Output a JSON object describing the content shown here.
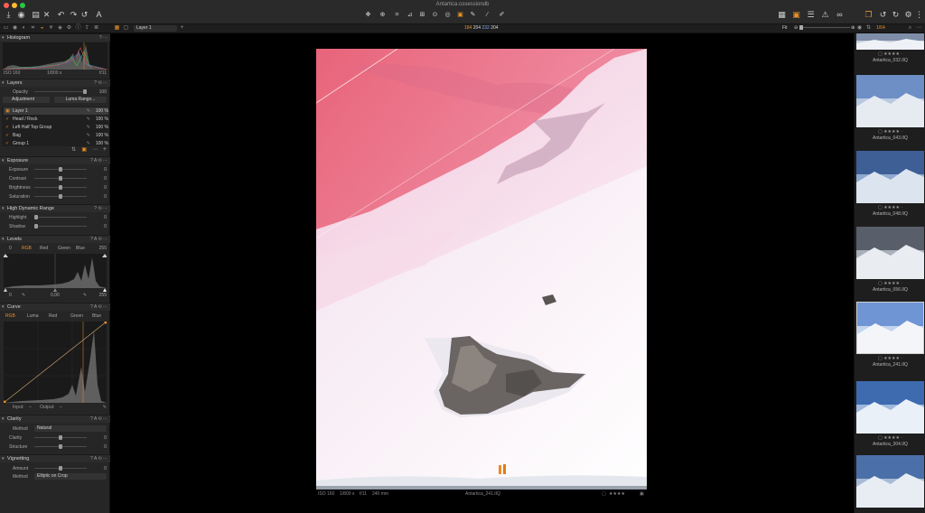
{
  "window": {
    "title": "Antartica.cosessiondb"
  },
  "colors": {
    "accent": "#e8902a",
    "panel": "#262626",
    "selected_thumb_border": "#cfcfcf"
  },
  "viewer_toolbar": {
    "layer_select": "Layer 1",
    "readout": {
      "r": "184",
      "g": "204",
      "b": "232",
      "a": "204"
    },
    "fit_label": "Fit"
  },
  "browser_header": {
    "count": "1/64"
  },
  "histogram": {
    "title": "Histogram",
    "iso": "ISO 160",
    "shutter": "1/800 s",
    "aperture": "f/11"
  },
  "layers": {
    "title": "Layers",
    "opacity_label": "Opacity",
    "opacity_value": "100",
    "opacity_level": 1.0,
    "type_select": "Adjustment",
    "luma_button": "Luma Range...",
    "items": [
      {
        "name": "Layer 1",
        "pct": "100 %"
      },
      {
        "name": "Head / Rock",
        "pct": "100 %"
      },
      {
        "name": "Left Half Top Group",
        "pct": "100 %"
      },
      {
        "name": "Bag",
        "pct": "100 %"
      },
      {
        "name": "Group 1",
        "pct": "100 %"
      }
    ]
  },
  "exposure": {
    "title": "Exposure",
    "rows": [
      {
        "label": "Exposure",
        "value": "0",
        "level": 0.5
      },
      {
        "label": "Contrast",
        "value": "0",
        "level": 0.5
      },
      {
        "label": "Brightness",
        "value": "0",
        "level": 0.5
      },
      {
        "label": "Saturation",
        "value": "0",
        "level": 0.5
      }
    ]
  },
  "hdr": {
    "title": "High Dynamic Range",
    "rows": [
      {
        "label": "Highlight",
        "value": "0",
        "level": 0.0
      },
      {
        "label": "Shadow",
        "value": "0",
        "level": 0.0
      }
    ]
  },
  "levels": {
    "title": "Levels",
    "left_value": "0",
    "right_value": "255",
    "channels": [
      "RGB",
      "Red",
      "Green",
      "Blue"
    ],
    "active_channel": "RGB",
    "min_input": "0",
    "mid_input": "0,00",
    "max_input": "255"
  },
  "curve": {
    "title": "Curve",
    "channels": [
      "RGB",
      "Luma",
      "Red",
      "Green",
      "Blue"
    ],
    "active_channel": "RGB",
    "input_label": "Input:",
    "input_value": "–",
    "output_label": "Output:",
    "output_value": "–"
  },
  "clarity": {
    "title": "Clarity",
    "method_label": "Method",
    "method_value": "Natural",
    "rows": [
      {
        "label": "Clarity",
        "value": "0",
        "level": 0.5
      },
      {
        "label": "Structure",
        "value": "0",
        "level": 0.5
      }
    ]
  },
  "vignetting": {
    "title": "Vignetting",
    "amount_label": "Amount",
    "amount_value": "0",
    "amount_level": 0.5,
    "method_label": "Method",
    "method_value": "Elliptic on Crop"
  },
  "viewer_info": {
    "iso": "ISO 160",
    "shutter": "1/800 s",
    "aperture": "f/11",
    "focal": "240 mm",
    "filename": "Antartica_241.IIQ",
    "rating": "★★★★"
  },
  "thumbnails": [
    {
      "name": "Antartica_032.IIQ",
      "stars": "★★★★",
      "selected": false
    },
    {
      "name": "Antartica_043.IIQ",
      "stars": "★★★★",
      "selected": false
    },
    {
      "name": "Antartica_048.IIQ",
      "stars": "★★★★",
      "selected": false
    },
    {
      "name": "Antartica_056.IIQ",
      "stars": "★★★★",
      "selected": false
    },
    {
      "name": "Antartica_241.IIQ",
      "stars": "★★★★",
      "selected": true
    },
    {
      "name": "Antartica_304.IIQ",
      "stars": "★★★★",
      "selected": false
    },
    {
      "name": "",
      "stars": "",
      "selected": false
    }
  ]
}
